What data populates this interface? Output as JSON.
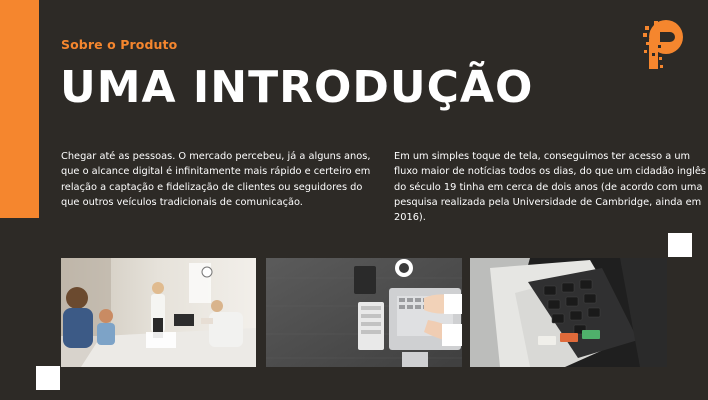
{
  "slide": {
    "subtitle": "Sobre o Produto",
    "title": "UMA INTRODUÇÃO",
    "paragraph_left": "Chegar até as pessoas. O mercado percebeu, já a alguns anos, que o alcance digital é infinitamente mais rápido e certeiro em relação a captação e fidelização de clientes ou seguidores do que outros veículos tradicionais de comunicação.",
    "paragraph_right": "Em um simples toque de tela, conseguimos ter acesso a um fluxo maior de notícias todos os dias, do que um cidadão inglês do século 19 tinha em cerca de dois anos (de acordo com uma pesquisa realizada pela Universidade de Cambridge, ainda em 2016)."
  },
  "logo": {
    "icon": "pixel-p-logo-icon"
  },
  "images": [
    {
      "name": "office-meeting-photo"
    },
    {
      "name": "desk-laptop-photo"
    },
    {
      "name": "voting-machine-photo"
    }
  ],
  "colors": {
    "accent": "#f5862e",
    "background": "#2d2a26",
    "text": "#ffffff"
  }
}
